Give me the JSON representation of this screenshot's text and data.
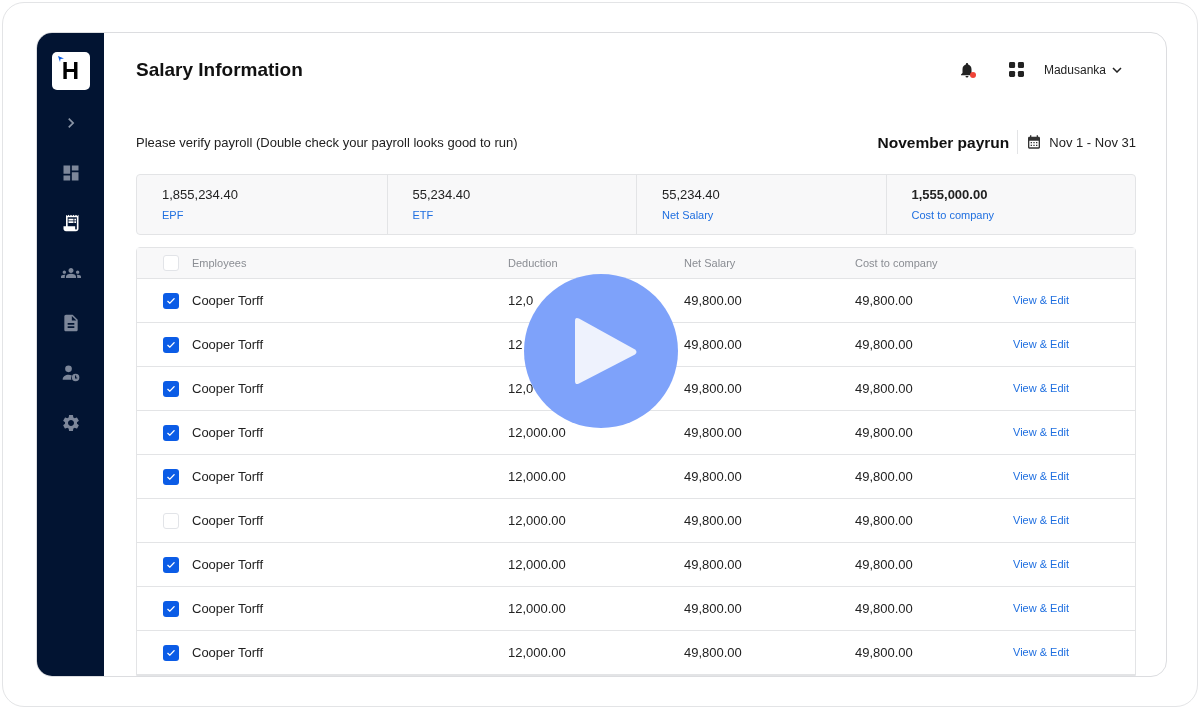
{
  "sidebar": {
    "logo": "H",
    "items": [
      {
        "selected": false
      },
      {
        "selected": true
      },
      {
        "selected": false
      },
      {
        "selected": false
      },
      {
        "selected": false
      },
      {
        "selected": false
      }
    ]
  },
  "header": {
    "title": "Salary Information",
    "notifications_unread": true,
    "user": "Madusanka"
  },
  "subheader": {
    "description": "Please verify payroll (Double check your payroll looks good to run)",
    "payrun": "November payrun",
    "date_range": "Nov 1 - Nov 31"
  },
  "stats": [
    {
      "value": "1,855,234.40",
      "label": "EPF",
      "bold": false
    },
    {
      "value": "55,234.40",
      "label": "ETF",
      "bold": false
    },
    {
      "value": "55,234.40",
      "label": "Net Salary",
      "bold": false
    },
    {
      "value": "1,555,000.00",
      "label": "Cost to company",
      "bold": true
    }
  ],
  "table": {
    "all_checked": false,
    "columns": [
      "Employees",
      "Deduction",
      "Net Salary",
      "Cost to company"
    ],
    "rows": [
      {
        "checked": true,
        "name": "Cooper Torff",
        "deduction": "12,0",
        "net_salary": "49,800.00",
        "cost": "49,800.00",
        "action": "View & Edit"
      },
      {
        "checked": true,
        "name": "Cooper Torff",
        "deduction": "12",
        "net_salary": "49,800.00",
        "cost": "49,800.00",
        "action": "View & Edit"
      },
      {
        "checked": true,
        "name": "Cooper Torff",
        "deduction": "12,0",
        "net_salary": "49,800.00",
        "cost": "49,800.00",
        "action": "View & Edit"
      },
      {
        "checked": true,
        "name": "Cooper Torff",
        "deduction": "12,000.00",
        "net_salary": "49,800.00",
        "cost": "49,800.00",
        "action": "View & Edit"
      },
      {
        "checked": true,
        "name": "Cooper Torff",
        "deduction": "12,000.00",
        "net_salary": "49,800.00",
        "cost": "49,800.00",
        "action": "View & Edit"
      },
      {
        "checked": false,
        "name": "Cooper Torff",
        "deduction": "12,000.00",
        "net_salary": "49,800.00",
        "cost": "49,800.00",
        "action": "View & Edit"
      },
      {
        "checked": true,
        "name": "Cooper Torff",
        "deduction": "12,000.00",
        "net_salary": "49,800.00",
        "cost": "49,800.00",
        "action": "View & Edit"
      },
      {
        "checked": true,
        "name": "Cooper Torff",
        "deduction": "12,000.00",
        "net_salary": "49,800.00",
        "cost": "49,800.00",
        "action": "View & Edit"
      },
      {
        "checked": true,
        "name": "Cooper Torff",
        "deduction": "12,000.00",
        "net_salary": "49,800.00",
        "cost": "49,800.00",
        "action": "View & Edit"
      }
    ]
  },
  "video_overlay": {
    "play_button": true
  }
}
